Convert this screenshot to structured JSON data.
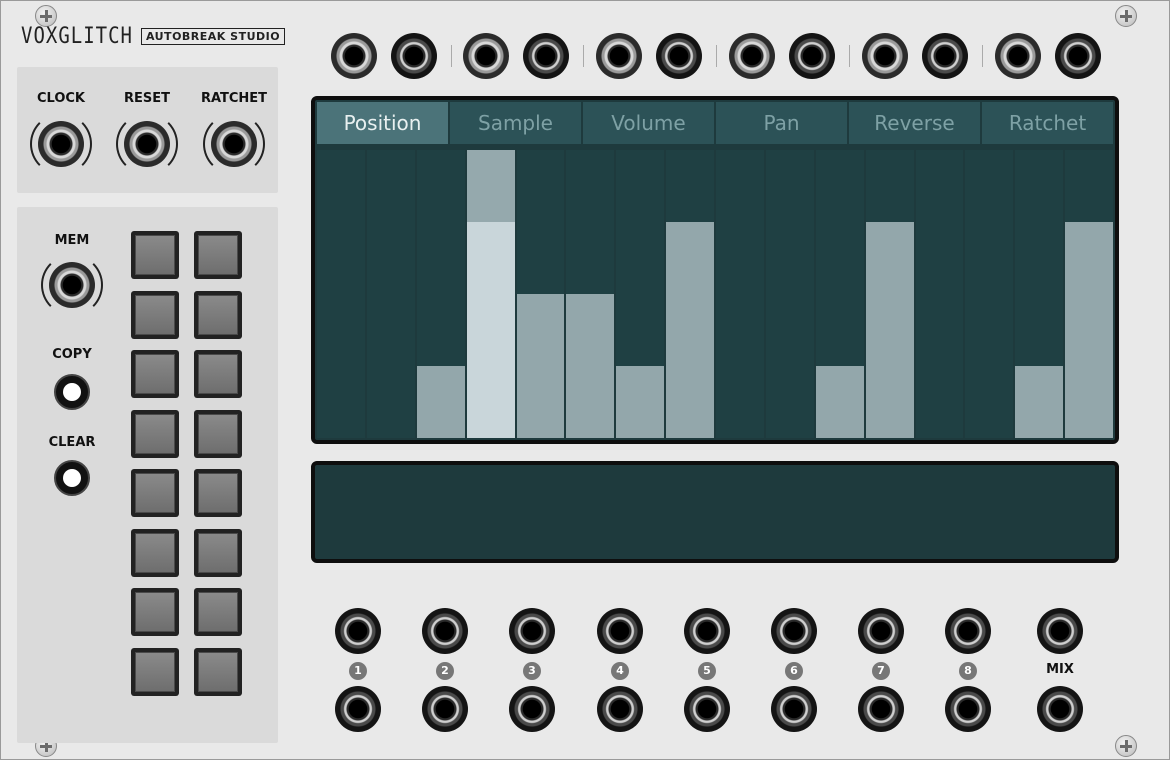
{
  "brand": {
    "logo": "VOXGLITCH",
    "studio": "AUTOBREAK STUDIO"
  },
  "inputs": {
    "clock": "CLOCK",
    "reset": "RESET",
    "ratchet": "RATCHET"
  },
  "memory": {
    "mem": "MEM",
    "copy": "COPY",
    "clear": "CLEAR",
    "slot_count": 16
  },
  "tabs": [
    "Position",
    "Sample",
    "Volume",
    "Pan",
    "Reverse",
    "Ratchet"
  ],
  "active_tab": "Position",
  "sequence": {
    "steps": 16,
    "values": [
      0,
      0,
      0.25,
      0.75,
      0.5,
      0.5,
      0.25,
      0.75,
      0,
      0,
      0.25,
      0.75,
      0,
      0,
      0.25,
      0.75
    ],
    "playhead_step": 4
  },
  "outputs": {
    "labels": [
      "1",
      "2",
      "3",
      "4",
      "5",
      "6",
      "7",
      "8"
    ],
    "mix": "MIX"
  }
}
